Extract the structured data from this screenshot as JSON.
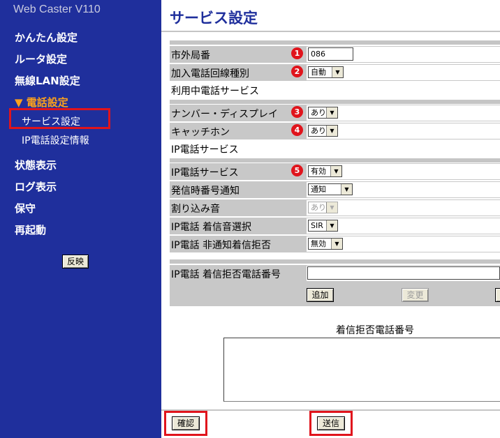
{
  "sidebar": {
    "brand": "Web Caster V110",
    "menu": [
      "かんたん設定",
      "ルータ設定",
      "無線LAN設定",
      "▼ 電話設定"
    ],
    "submenu": [
      "サービス設定",
      "IP電話設定情報"
    ],
    "menu2": [
      "状態表示",
      "ログ表示",
      "保守",
      "再起動"
    ],
    "apply_label": "反映"
  },
  "page": {
    "title": "サービス設定"
  },
  "section1": {
    "area_code": {
      "label": "市外局番",
      "badge": "1",
      "value": "086"
    },
    "line_type": {
      "label": "加入電話回線種別",
      "badge": "2",
      "value": "自動"
    }
  },
  "section2": {
    "heading": "利用中電話サービス",
    "number_display": {
      "label": "ナンバー・ディスプレイ",
      "badge": "3",
      "value": "あり"
    },
    "catch_phone": {
      "label": "キャッチホン",
      "badge": "4",
      "value": "あり"
    }
  },
  "section3": {
    "heading": "IP電話サービス",
    "ip_service": {
      "label": "IP電話サービス",
      "badge": "5",
      "value": "有効"
    },
    "caller_id": {
      "label": "発信時番号通知",
      "value": "通知"
    },
    "interrupt_tone": {
      "label": "割り込み音",
      "value": "あり"
    },
    "ringtone": {
      "label": "IP電話 着信音選択",
      "value": "SIR"
    },
    "reject_anon": {
      "label": "IP電話 非通知着信拒否",
      "value": "無効"
    }
  },
  "section4": {
    "reject_number": {
      "label": "IP電話 着信拒否電話番号",
      "value": ""
    },
    "add_label": "追加",
    "change_label": "変更",
    "list_heading": "着信拒否電話番号"
  },
  "footer": {
    "confirm_label": "確認",
    "submit_label": "送信"
  },
  "colors": {
    "sidebar": "#1f2f9c",
    "accent_orange": "#ffa21a",
    "highlight_red": "#e0141c",
    "row_gray": "#c8c8c8"
  }
}
